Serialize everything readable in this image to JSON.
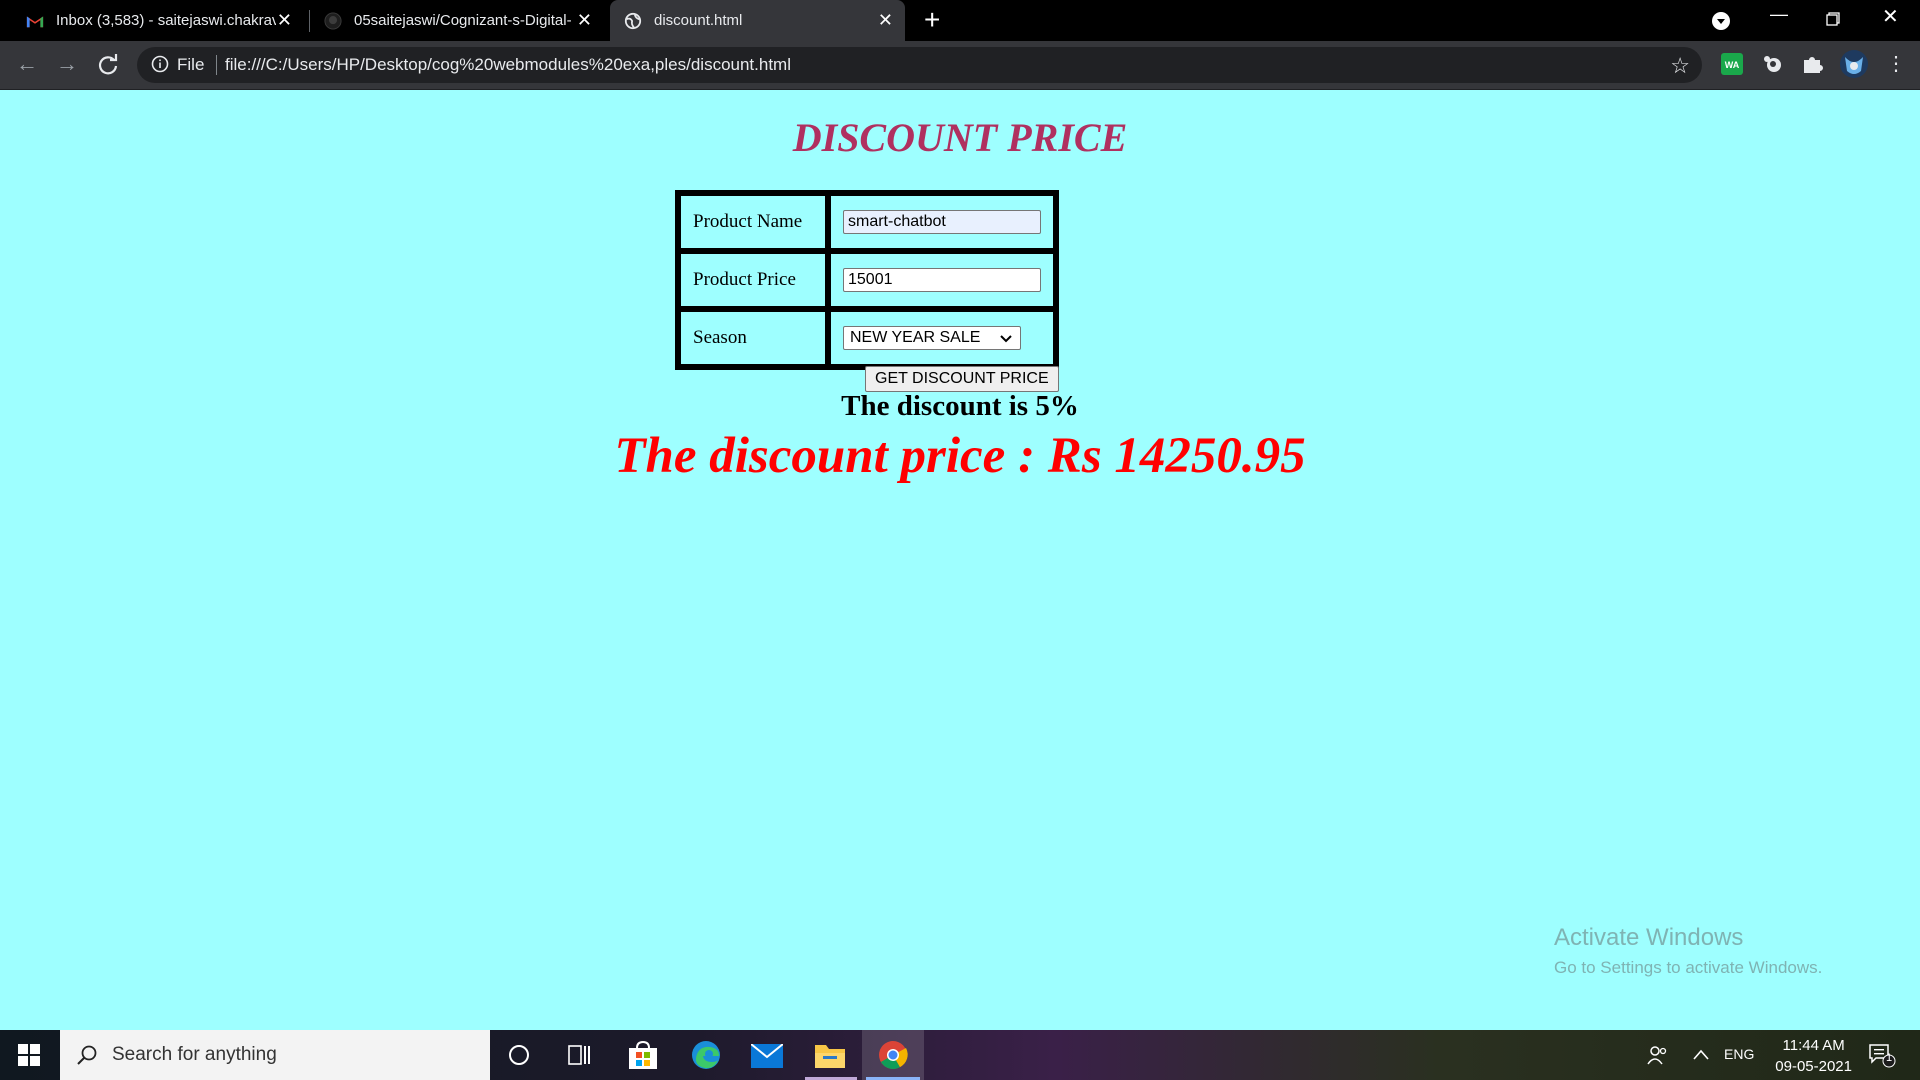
{
  "browser": {
    "tabs": [
      {
        "title": "Inbox (3,583) - saitejaswi.chakrav",
        "icon": "gmail-icon"
      },
      {
        "title": "05saitejaswi/Cognizant-s-Digital-",
        "icon": "github-icon"
      },
      {
        "title": "discount.html",
        "icon": "globe-icon"
      }
    ],
    "address": {
      "scheme_label": "File",
      "url": "file:///C:/Users/HP/Desktop/cog%20webmodules%20exa,ples/discount.html"
    }
  },
  "page": {
    "heading": "DISCOUNT PRICE",
    "form": {
      "product_name_label": "Product Name",
      "product_name_value": "smart-chatbot",
      "product_price_label": "Product Price",
      "product_price_value": "15001",
      "season_label": "Season",
      "season_selected": "NEW YEAR SALE"
    },
    "button_label": "GET DISCOUNT PRICE",
    "discount_text": "The discount is 5%",
    "discount_price_text": "The discount price : Rs 14250.95",
    "watermark": {
      "line1": "Activate Windows",
      "line2": "Go to Settings to activate Windows."
    }
  },
  "taskbar": {
    "search_placeholder": "Search for anything",
    "language": "ENG",
    "time": "11:44 AM",
    "date": "09-05-2021",
    "notification_count": "1"
  },
  "colors": {
    "page_background": "#9effff",
    "heading": "#b03060",
    "discount_price": "#ff0000"
  }
}
